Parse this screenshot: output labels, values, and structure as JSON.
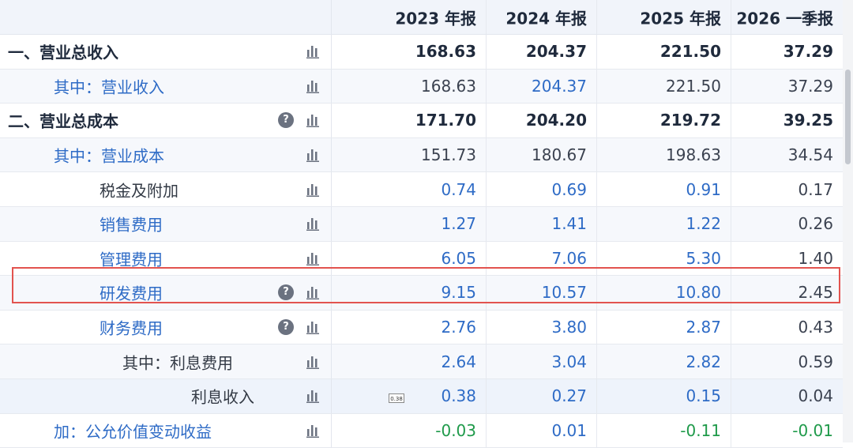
{
  "columns": [
    "2023 年报",
    "2024 年报",
    "2025 年报",
    "2026 一季报"
  ],
  "rows": [
    {
      "label": "一、营业总收入",
      "values": [
        "168.63",
        "204.37",
        "221.50",
        "37.29"
      ]
    },
    {
      "label": "其中：营业收入",
      "values": [
        "168.63",
        "204.37",
        "221.50",
        "37.29"
      ]
    },
    {
      "label": "二、营业总成本",
      "values": [
        "171.70",
        "204.20",
        "219.72",
        "39.25"
      ]
    },
    {
      "label": "其中：营业成本",
      "values": [
        "151.73",
        "180.67",
        "198.63",
        "34.54"
      ]
    },
    {
      "label": "税金及附加",
      "values": [
        "0.74",
        "0.69",
        "0.91",
        "0.17"
      ]
    },
    {
      "label": "销售费用",
      "values": [
        "1.27",
        "1.41",
        "1.22",
        "0.26"
      ]
    },
    {
      "label": "管理费用",
      "values": [
        "6.05",
        "7.06",
        "5.30",
        "1.40"
      ]
    },
    {
      "label": "研发费用",
      "values": [
        "9.15",
        "10.57",
        "10.80",
        "2.45"
      ]
    },
    {
      "label": "财务费用",
      "values": [
        "2.76",
        "3.80",
        "2.87",
        "0.43"
      ]
    },
    {
      "label": "其中：利息费用",
      "values": [
        "2.64",
        "3.04",
        "2.82",
        "0.59"
      ]
    },
    {
      "label": "利息收入",
      "values": [
        "0.38",
        "0.27",
        "0.15",
        "0.04"
      ]
    },
    {
      "label": "加：公允价值变动收益",
      "values": [
        "-0.03",
        "0.01",
        "-0.11",
        "-0.01"
      ]
    }
  ],
  "help_icon_glyph": "?",
  "tooltip_text": "0.38",
  "icons": {
    "chart": "bar-chart-icon",
    "help": "help-circle-icon"
  },
  "colors": {
    "blue": "#2e6bc6",
    "green": "#1f9a4a",
    "highlight": "#e2534f"
  }
}
